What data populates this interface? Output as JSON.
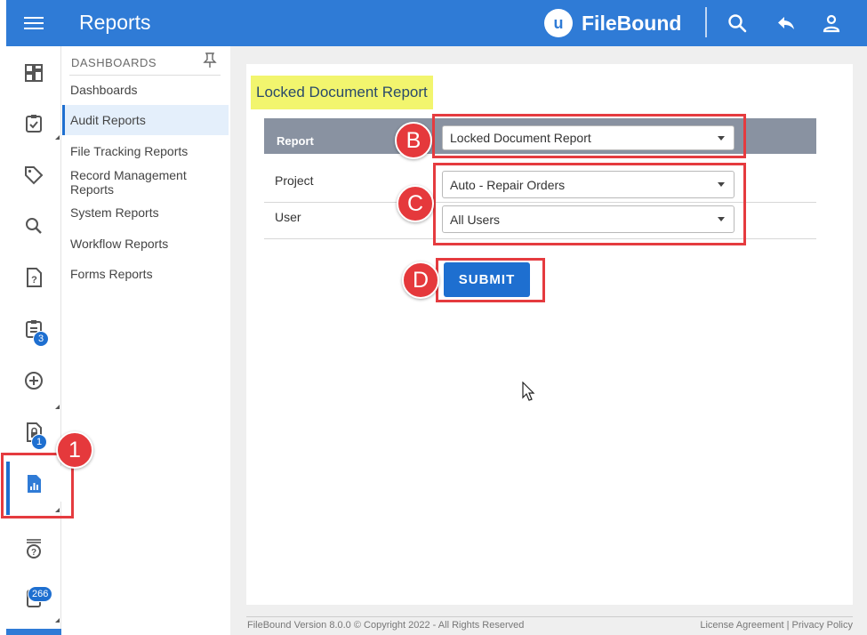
{
  "header": {
    "title": "Reports",
    "brand_logo_letter": "u",
    "brand_name": "FileBound"
  },
  "rail": {
    "badges": {
      "tasks": "3",
      "locked": "1",
      "queue": "266"
    }
  },
  "submenu": {
    "header": "DASHBOARDS",
    "items": [
      {
        "label": "Dashboards"
      },
      {
        "label": "Audit Reports"
      },
      {
        "label": "File Tracking Reports"
      },
      {
        "label": "Record Management Reports"
      },
      {
        "label": "System Reports"
      },
      {
        "label": "Workflow Reports"
      },
      {
        "label": "Forms Reports"
      }
    ]
  },
  "main": {
    "title": "Locked Document Report",
    "form": {
      "report_label": "Report",
      "report_value": "Locked Document Report",
      "project_label": "Project",
      "project_value": "Auto - Repair Orders",
      "user_label": "User",
      "user_value": "All Users",
      "submit_label": "SUBMIT"
    }
  },
  "annotations": {
    "one": "1",
    "b": "B",
    "c": "C",
    "d": "D"
  },
  "footer": {
    "version": "FileBound Version 8.0.0 © Copyright 2022 - All Rights Reserved",
    "license": "License Agreement",
    "separator": "|",
    "privacy": "Privacy Policy"
  },
  "colors": {
    "primary": "#2f7bd6",
    "header_row": "#8992a1",
    "highlight": "#f2f56e",
    "annotation": "#e5393c"
  }
}
